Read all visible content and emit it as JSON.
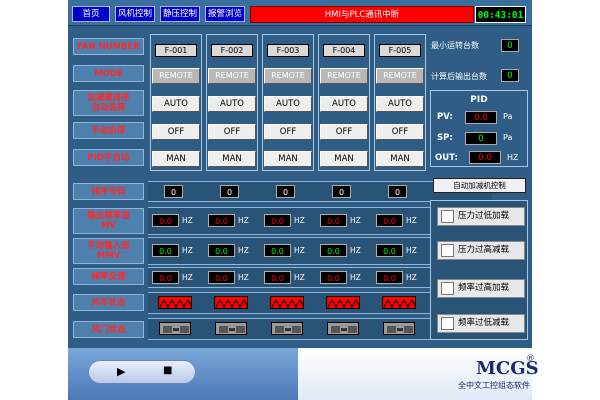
{
  "nav": {
    "home": "首页",
    "fan_control": "风机控制",
    "pressure_control": "静压控制",
    "alarm_browse": "报警浏览",
    "alarm_message": "HMI与PLC通讯中断",
    "clock": "00:43:01"
  },
  "labels": {
    "fan_number": "FAN NUMBER",
    "mode": "MODE",
    "add_remove_sort_1": "加减载排序",
    "add_remove_sort_2": "自动选择",
    "manual_start_stop": "手动启停",
    "pid_manual_auto": "PID手自动",
    "sort_number": "排序号码",
    "output_freq_1": "输出频率值",
    "output_freq_2": "MV",
    "manual_input_1": "手动输入值",
    "manual_input_2": "MMV",
    "freq_feedback": "频率反馈",
    "fan_status": "风车状态",
    "damper_status": "风门状态"
  },
  "fans": [
    {
      "id": "F-001",
      "mode": "REMOTE",
      "auto": "AUTO",
      "onoff": "OFF",
      "man": "MAN",
      "sort": "0",
      "mv": "0.0",
      "mmv": "0.0",
      "fb": "0.0"
    },
    {
      "id": "F-002",
      "mode": "REMOTE",
      "auto": "AUTO",
      "onoff": "OFF",
      "man": "MAN",
      "sort": "0",
      "mv": "0.0",
      "mmv": "0.0",
      "fb": "0.0"
    },
    {
      "id": "F-003",
      "mode": "REMOTE",
      "auto": "AUTO",
      "onoff": "OFF",
      "man": "MAN",
      "sort": "0",
      "mv": "0.0",
      "mmv": "0.0",
      "fb": "0.0"
    },
    {
      "id": "F-004",
      "mode": "REMOTE",
      "auto": "AUTO",
      "onoff": "OFF",
      "man": "MAN",
      "sort": "0",
      "mv": "0.0",
      "mmv": "0.0",
      "fb": "0.0"
    },
    {
      "id": "F-005",
      "mode": "REMOTE",
      "auto": "AUTO",
      "onoff": "OFF",
      "man": "MAN",
      "sort": "0",
      "mv": "0.0",
      "mmv": "0.0",
      "fb": "0.0"
    }
  ],
  "unit_hz": "HZ",
  "right": {
    "min_running_label": "最小运转台数",
    "min_running_value": "0",
    "calc_output_label": "计算后输出台数",
    "calc_output_value": "0",
    "pid_title": "PID",
    "pv_label": "PV:",
    "pv_value": "0.0",
    "pv_unit": "Pa",
    "sp_label": "SP:",
    "sp_value": "0",
    "sp_unit": "Pa",
    "out_label": "OUT:",
    "out_value": "0.0",
    "out_unit": "HZ",
    "auto_add_remove": "自动加减机控制",
    "alarms": [
      "压力过低加载",
      "压力过高减载",
      "频率过高加载",
      "频率过低减载"
    ]
  },
  "footer": {
    "play": "▶",
    "stop": "■",
    "logo": "MCGS",
    "logo_mark": "®",
    "logo_sub": "全中文工控组态软件"
  },
  "colors": {
    "screen_bg": "#2f5d86",
    "alarm_red": "#ff0000",
    "value_red": "#ff0000",
    "value_green": "#00ff00",
    "nav_blue": "#0000c8"
  }
}
